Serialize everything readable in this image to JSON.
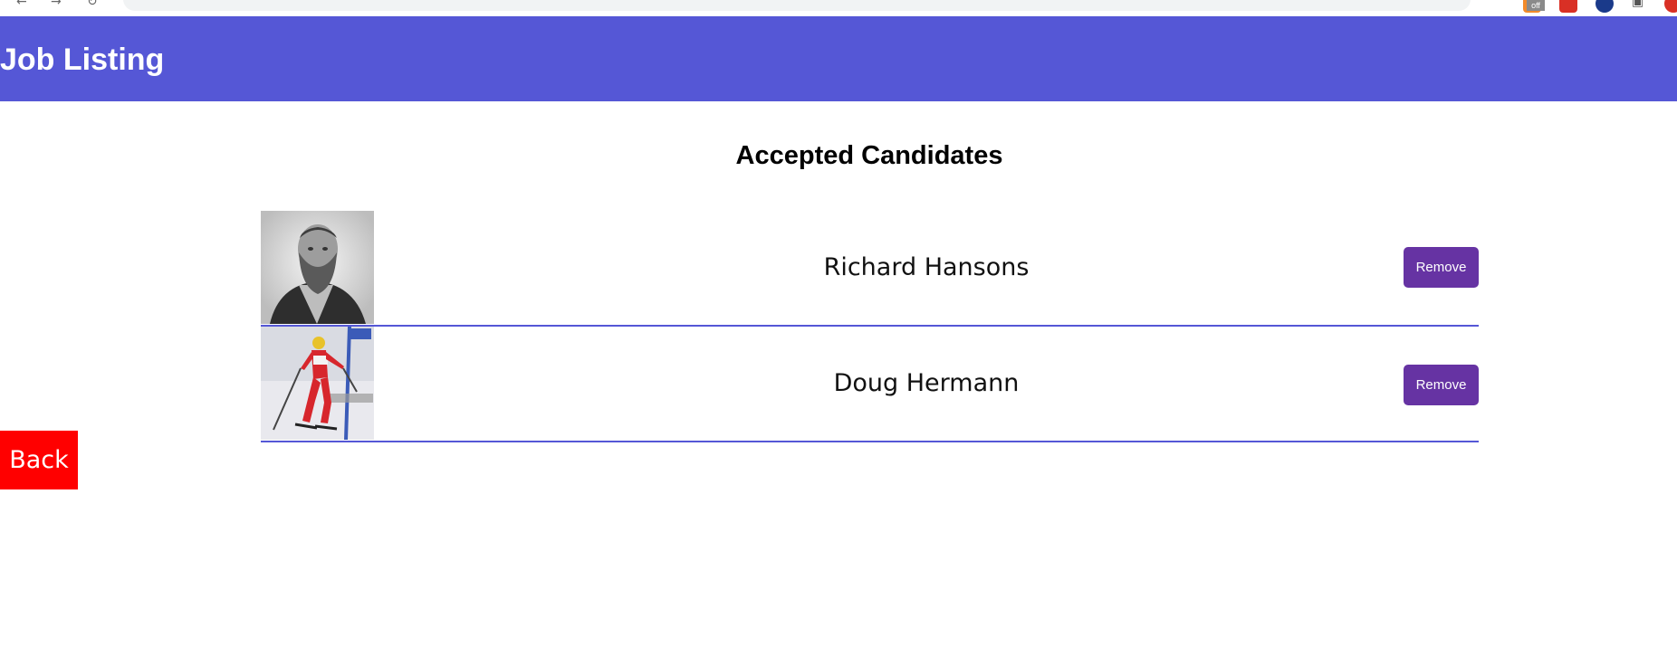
{
  "header": {
    "title": "Job Listing"
  },
  "section": {
    "title": "Accepted Candidates"
  },
  "candidates": [
    {
      "name": "Richard Hansons",
      "remove_label": "Remove",
      "photo": "portrait-photo"
    },
    {
      "name": "Doug Hermann",
      "remove_label": "Remove",
      "photo": "skier-photo"
    }
  ],
  "back_label": "Back",
  "browser": {
    "extension_badge": "off"
  },
  "colors": {
    "header_bg": "#5557d6",
    "remove_button": "#6633a3",
    "back_button": "#ff0000",
    "row_divider": "#5557d6"
  }
}
